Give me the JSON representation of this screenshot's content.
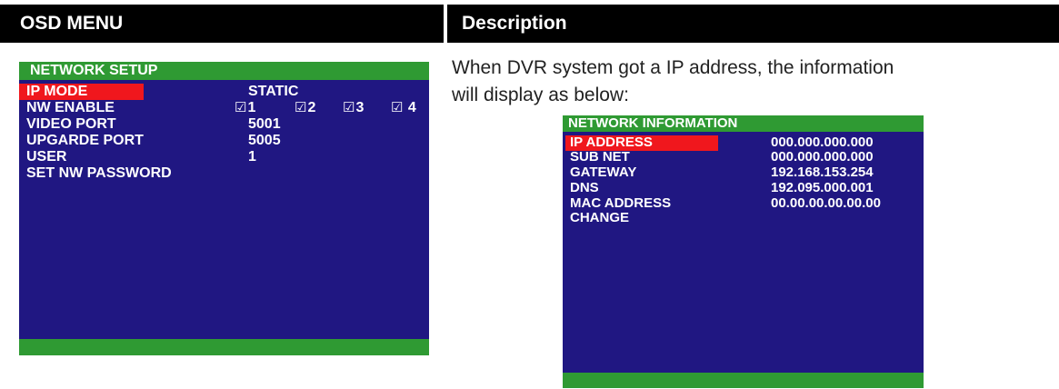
{
  "header": {
    "left": "OSD MENU",
    "right": "Description"
  },
  "description": {
    "line1": "When DVR system got a IP address, the information",
    "line2": "will display as below:"
  },
  "network_setup": {
    "title": "NETWORK SETUP",
    "rows": [
      {
        "label": "IP MODE",
        "value": "STATIC",
        "selected": true
      },
      {
        "label": "NW ENABLE",
        "value": ""
      },
      {
        "label": "VIDEO PORT",
        "value": "5001"
      },
      {
        "label": "UPGARDE PORT",
        "value": "5005"
      },
      {
        "label": "USER",
        "value": "1"
      },
      {
        "label": "SET NW PASSWORD",
        "value": ""
      }
    ],
    "checkbox_glyph": "☑",
    "channels": [
      "1",
      "2",
      "3",
      "4"
    ]
  },
  "network_information": {
    "title": "NETWORK INFORMATION",
    "rows": [
      {
        "label": "IP ADDRESS",
        "value": "000.000.000.000",
        "selected": true
      },
      {
        "label": "SUB NET",
        "value": "000.000.000.000"
      },
      {
        "label": "GATEWAY",
        "value": "192.168.153.254"
      },
      {
        "label": "DNS",
        "value": "192.095.000.001"
      },
      {
        "label": "MAC ADDRESS",
        "value": "00.00.00.00.00.00"
      },
      {
        "label": "CHANGE",
        "value": ""
      }
    ]
  },
  "colors": {
    "osd_background": "#201782",
    "title_bar": "#2f9a33",
    "selection": "#f0171d",
    "header_background": "#000000"
  }
}
